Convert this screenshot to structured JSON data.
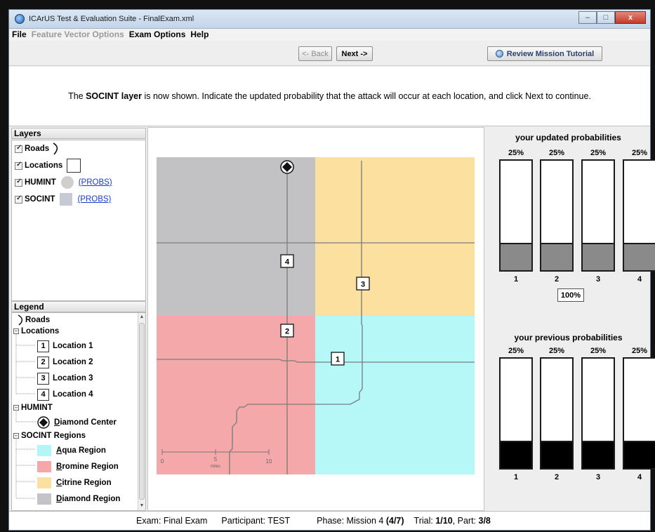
{
  "window": {
    "title": "ICArUS Test & Evaluation Suite - FinalExam.xml",
    "minimize": "–",
    "maximize": "□",
    "close": "x"
  },
  "menu": {
    "file": "File",
    "feature_vector": "Feature Vector Options",
    "exam_options": "Exam Options",
    "help": "Help"
  },
  "toolbar": {
    "back": "<- Back",
    "next": "Next ->",
    "tutorial": "Review Mission Tutorial"
  },
  "instruction": {
    "pre": "The ",
    "bold": "SOCINT layer",
    "post": " is now shown. Indicate the updated probability that the attack will occur at each location, and click Next to continue."
  },
  "layers": {
    "header": "Layers",
    "roads": "Roads",
    "locations": "Locations",
    "humint": "HUMINT",
    "socint": "SOCINT",
    "probs_link": "(PROBS)"
  },
  "legend": {
    "header": "Legend",
    "roads": "Roads",
    "locations_group": "Locations",
    "locations": [
      {
        "num": "1",
        "label": "Location 1"
      },
      {
        "num": "2",
        "label": "Location 2"
      },
      {
        "num": "3",
        "label": "Location 3"
      },
      {
        "num": "4",
        "label": "Location 4"
      }
    ],
    "humint_group": "HUMINT",
    "diamond_center": "Diamond Center",
    "socint_group": "SOCINT Regions",
    "regions": [
      {
        "label": "Aqua Region",
        "color": "#b4f5f7"
      },
      {
        "label": "Bromine Region",
        "color": "#f5a8aa"
      },
      {
        "label": "Citrine Region",
        "color": "#fbe0a0"
      },
      {
        "label": "Diamond Region",
        "color": "#c4c4c8"
      }
    ]
  },
  "map": {
    "colors": {
      "diamond": "#c2c2c4",
      "citrine": "#fbe0a0",
      "bromine": "#f5a8aa",
      "aqua": "#b6f7f8",
      "road": "#7b7b7b"
    },
    "location_labels": [
      "1",
      "2",
      "3",
      "4"
    ],
    "scale": {
      "start": "0",
      "mid": "5",
      "end": "10",
      "unit": "miles"
    }
  },
  "updated": {
    "title": "your updated probabilities",
    "percents": [
      "25%",
      "25%",
      "25%",
      "25%"
    ],
    "values": [
      0.25,
      0.25,
      0.25,
      0.25
    ],
    "labels": [
      "1",
      "2",
      "3",
      "4"
    ],
    "total": "100%",
    "fill_color": "#8a8a8a"
  },
  "previous": {
    "title": "your previous probabilities",
    "percents": [
      "25%",
      "25%",
      "25%",
      "25%"
    ],
    "values": [
      0.25,
      0.25,
      0.25,
      0.25
    ],
    "labels": [
      "1",
      "2",
      "3",
      "4"
    ],
    "fill_color": "#000000"
  },
  "status": {
    "exam_label": "Exam: Final Exam",
    "participant_label": "Participant: TEST",
    "phase_prefix": "Phase: Mission 4 ",
    "phase_bold": "(4/7)",
    "trial_prefix": "Trial: ",
    "trial_bold": "1/10",
    "part_prefix": ", Part: ",
    "part_bold": "3/8"
  }
}
